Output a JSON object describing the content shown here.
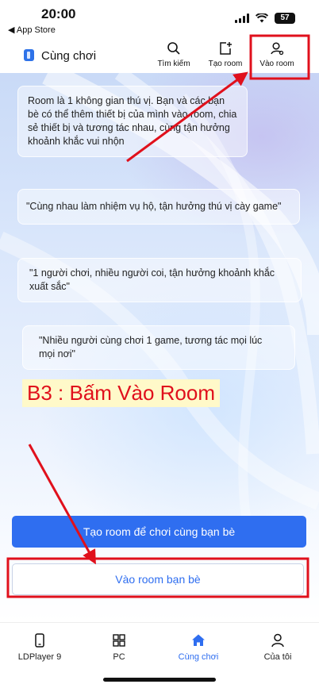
{
  "status_bar": {
    "time": "20:00",
    "back_label": "◀ App Store",
    "battery": "57"
  },
  "header": {
    "app_title": "Cùng chơi",
    "actions": [
      {
        "label": "Tìm kiếm",
        "icon": "search-icon"
      },
      {
        "label": "Tạo room",
        "icon": "create-room-icon"
      },
      {
        "label": "Vào room",
        "icon": "join-room-icon"
      }
    ]
  },
  "main": {
    "intro_text": "Room là 1 không gian thú vị. Bạn và các bạn bè có thể thêm thiết bị của mình vào room, chia sẻ thiết bị và tương tác nhau, cùng tận hưởng khoảnh khắc vui nhộn",
    "quotes": [
      "\"Cùng nhau làm nhiệm vụ hộ, tận hưởng thú vị cày game\"",
      "\"1 người chơi, nhiều người coi, tận hưởng khoảnh khắc xuất sắc\"",
      "\"Nhiều người cùng chơi 1 game, tương tác mọi lúc mọi nơi\""
    ],
    "step_annotation": "B3 : Bấm Vào Room",
    "create_button": "Tạo room để chơi cùng bạn bè",
    "join_button": "Vào room bạn bè"
  },
  "tabbar": {
    "items": [
      {
        "label": "LDPlayer 9",
        "icon": "phone-icon",
        "active": false
      },
      {
        "label": "PC",
        "icon": "windows-icon",
        "active": false
      },
      {
        "label": "Cùng chơi",
        "icon": "home-icon",
        "active": true
      },
      {
        "label": "Của tôi",
        "icon": "user-icon",
        "active": false
      }
    ]
  },
  "colors": {
    "accent": "#2f6ef0",
    "annotation_red": "#e0101c",
    "annotation_bg": "#fff9c9"
  }
}
